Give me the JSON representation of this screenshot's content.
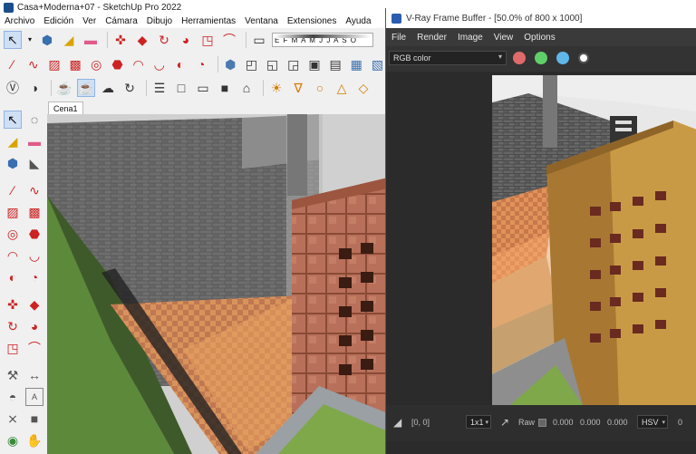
{
  "sketchup": {
    "title": "Casa+Moderna+07 - SketchUp Pro 2022",
    "menu": [
      "Archivo",
      "Edición",
      "Ver",
      "Cámara",
      "Dibujo",
      "Herramientas",
      "Ventana",
      "Extensiones",
      "Ayuda"
    ],
    "months": "E F M A M J J A S O",
    "scene_tab": "Cena1"
  },
  "vray": {
    "title": "V-Ray Frame Buffer - [50.0% of 800 x 1000]",
    "menu": [
      "File",
      "Render",
      "Image",
      "View",
      "Options"
    ],
    "channel": "RGB color",
    "coords": "[0, 0]",
    "ratio": "1x1",
    "raw_label": "Raw",
    "values": [
      "0.000",
      "0.000",
      "0.000"
    ],
    "color_mode": "HSV",
    "color_mode_value": "0",
    "colors": {
      "red": "#e06a6a",
      "green": "#5fcf6a",
      "blue": "#5fb6e8"
    }
  }
}
